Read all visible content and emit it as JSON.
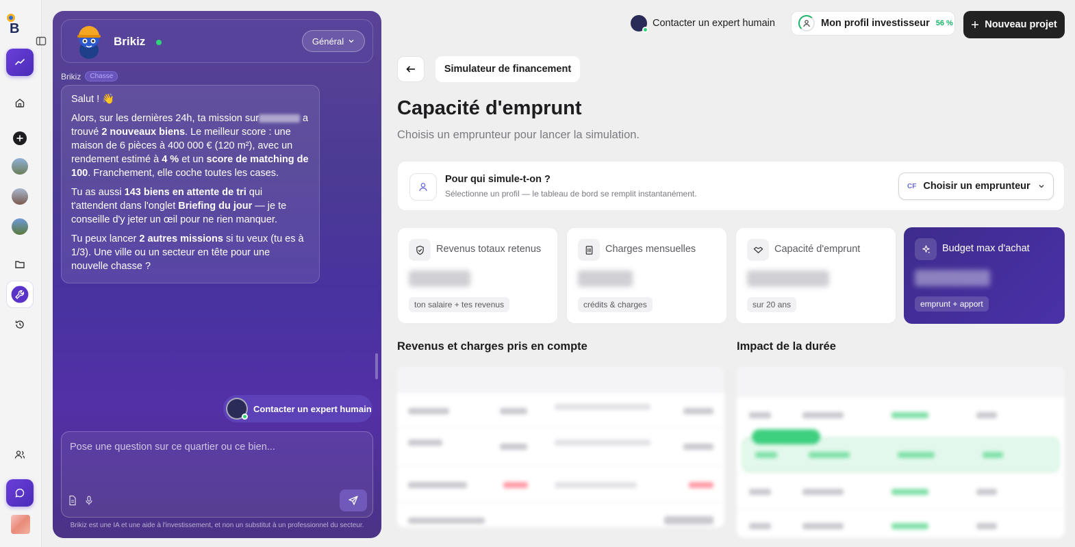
{
  "sidebar": {
    "logo": "B",
    "items": [
      {
        "name": "trending",
        "icon": "trend-up-icon"
      },
      {
        "name": "home",
        "icon": "home-icon"
      },
      {
        "name": "add",
        "icon": "plus-circle-icon"
      },
      {
        "name": "history",
        "icon": "history-icon"
      }
    ]
  },
  "chat": {
    "bot_name": "Brikiz",
    "scope": "Général",
    "sender": "Brikiz",
    "mode_badge": "Chasse",
    "greeting": "Salut ! 👋",
    "p1_a": "Alors, sur les dernières 24h, ta mission sur",
    "p1_b": "a trouvé",
    "p1_c": "2 nouveaux biens",
    "p1_d": ". Le meilleur score : une maison de 6 pièces à 400 000 € (120 m²), avec un rendement estimé à",
    "p1_e": "4 %",
    "p1_f": "et un",
    "p1_g": "score de matching de 100",
    "p1_h": ". Franchement, elle coche toutes les cases.",
    "p2_a": "Tu as aussi",
    "p2_b": "143 biens en attente de tri",
    "p2_c": "qui t'attendent dans l'onglet",
    "p2_d": "Briefing du jour",
    "p2_e": "— je te conseille d'y jeter un œil pour ne rien manquer.",
    "p3_a": "Tu peux lancer",
    "p3_b": "2 autres missions",
    "p3_c": "si tu veux (tu es à 1/3). Une ville ou un secteur en tête pour une nouvelle chasse ?",
    "expert_button": "Contacter un expert humain",
    "input_placeholder": "Pose une question sur ce quartier ou ce bien...",
    "disclaimer": "Brikiz est une IA et une aide à l'investissement, et non un substitut à un professionnel du secteur."
  },
  "topbar": {
    "expert_link": "Contacter un expert humain",
    "profile_label": "Mon profil investisseur",
    "profile_pct": "56 %",
    "new_project": "Nouveau projet"
  },
  "main": {
    "breadcrumb": "Simulateur de financement",
    "title": "Capacité d'emprunt",
    "subtitle": "Choisis un emprunteur pour lancer la simulation.",
    "borrower": {
      "question": "Pour qui simule-t-on ?",
      "hint": "Sélectionne un profil — le tableau de bord se remplit instantanément.",
      "initials": "CF",
      "select_label": "Choisir un emprunteur"
    },
    "kpis": [
      {
        "label": "Revenus totaux retenus",
        "tag": "ton salaire + tes revenus",
        "icon": "shield-icon"
      },
      {
        "label": "Charges mensuelles",
        "tag": "crédits & charges",
        "icon": "building-icon"
      },
      {
        "label": "Capacité d'emprunt",
        "tag": "sur 20 ans",
        "icon": "handshake-icon"
      },
      {
        "label": "Budget max d'achat",
        "tag": "emprunt + apport",
        "icon": "sparkle-icon"
      }
    ],
    "section_left": "Revenus et charges pris en compte",
    "section_right": "Impact de la durée"
  }
}
